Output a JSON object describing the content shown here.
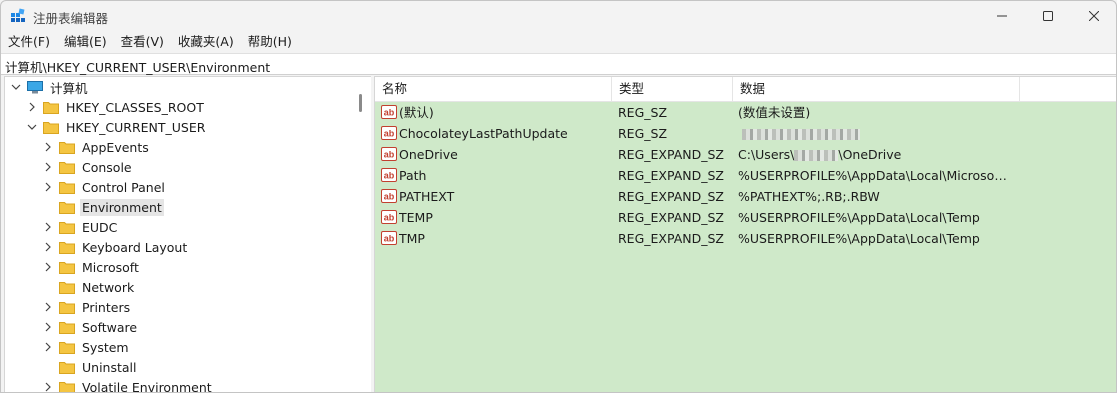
{
  "window": {
    "title": "注册表编辑器"
  },
  "menu": [
    {
      "label": "文件(F)"
    },
    {
      "label": "编辑(E)"
    },
    {
      "label": "查看(V)"
    },
    {
      "label": "收藏夹(A)"
    },
    {
      "label": "帮助(H)"
    }
  ],
  "address": {
    "path": "计算机\\HKEY_CURRENT_USER\\Environment"
  },
  "tree": {
    "root": {
      "label": "计算机",
      "icon": "computer-icon"
    },
    "hives": [
      {
        "label": "HKEY_CLASSES_ROOT"
      },
      {
        "label": "HKEY_CURRENT_USER"
      }
    ],
    "children": [
      {
        "label": "AppEvents",
        "expandable": true
      },
      {
        "label": "Console",
        "expandable": true
      },
      {
        "label": "Control Panel",
        "expandable": true
      },
      {
        "label": "Environment",
        "expandable": false,
        "selected": true
      },
      {
        "label": "EUDC",
        "expandable": true
      },
      {
        "label": "Keyboard Layout",
        "expandable": true
      },
      {
        "label": "Microsoft",
        "expandable": true
      },
      {
        "label": "Network",
        "expandable": false
      },
      {
        "label": "Printers",
        "expandable": true
      },
      {
        "label": "Software",
        "expandable": true
      },
      {
        "label": "System",
        "expandable": true
      },
      {
        "label": "Uninstall",
        "expandable": false
      },
      {
        "label": "Volatile Environment",
        "expandable": true
      }
    ]
  },
  "list": {
    "columns": [
      {
        "label": "名称"
      },
      {
        "label": "类型"
      },
      {
        "label": "数据"
      }
    ],
    "rows": [
      {
        "name": "(默认)",
        "type": "REG_SZ",
        "data": "(数值未设置)"
      },
      {
        "name": "ChocolateyLastPathUpdate",
        "type": "REG_SZ",
        "data": ""
      },
      {
        "name": "OneDrive",
        "type": "REG_EXPAND_SZ",
        "data_prefix": "C:\\Users\\",
        "data_suffix": "\\OneDrive"
      },
      {
        "name": "Path",
        "type": "REG_EXPAND_SZ",
        "data": "%USERPROFILE%\\AppData\\Local\\Microsoft\\..."
      },
      {
        "name": "PATHEXT",
        "type": "REG_EXPAND_SZ",
        "data": "%PATHEXT%;.RB;.RBW"
      },
      {
        "name": "TEMP",
        "type": "REG_EXPAND_SZ",
        "data": "%USERPROFILE%\\AppData\\Local\\Temp"
      },
      {
        "name": "TMP",
        "type": "REG_EXPAND_SZ",
        "data": "%USERPROFILE%\\AppData\\Local\\Temp"
      }
    ],
    "background_color": "#cfe9c9"
  },
  "colors": {
    "folder": "#f4c542",
    "selection": "#e5e5e5",
    "icon_red": "#c2402f"
  }
}
